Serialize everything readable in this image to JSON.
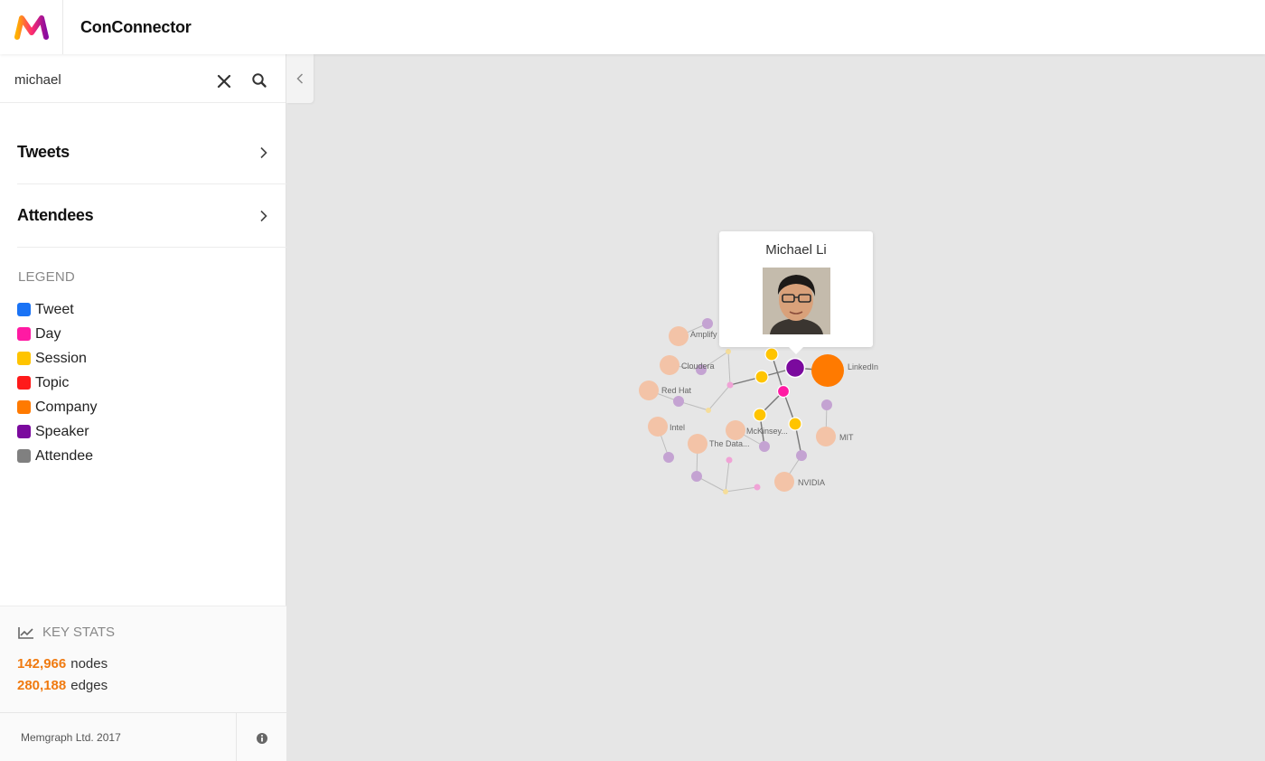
{
  "app": {
    "title": "ConConnector"
  },
  "search": {
    "value": "michael"
  },
  "sections": [
    {
      "label": "Tweets"
    },
    {
      "label": "Attendees"
    }
  ],
  "legend": {
    "title": "LEGEND",
    "items": [
      {
        "label": "Tweet",
        "color": "#1a73f5"
      },
      {
        "label": "Day",
        "color": "#ff1aa3"
      },
      {
        "label": "Session",
        "color": "#ffc400"
      },
      {
        "label": "Topic",
        "color": "#ff1a1a"
      },
      {
        "label": "Company",
        "color": "#ff7a00"
      },
      {
        "label": "Speaker",
        "color": "#7b0a9e"
      },
      {
        "label": "Attendee",
        "color": "#808080"
      }
    ]
  },
  "stats": {
    "title": "KEY STATS",
    "nodes_value": "142,966",
    "nodes_label": "nodes",
    "edges_value": "280,188",
    "edges_label": "edges"
  },
  "footer": {
    "text": "Memgraph Ltd. 2017"
  },
  "graph": {
    "labels": [
      "Amplify",
      "Cloudera",
      "Red Hat",
      "Intel",
      "The Data...",
      "McKinsey...",
      "NVIDIA",
      "MIT",
      "LinkedIn"
    ]
  },
  "tooltip": {
    "name": "Michael Li"
  },
  "colors": {
    "accent": "#f07a10"
  }
}
